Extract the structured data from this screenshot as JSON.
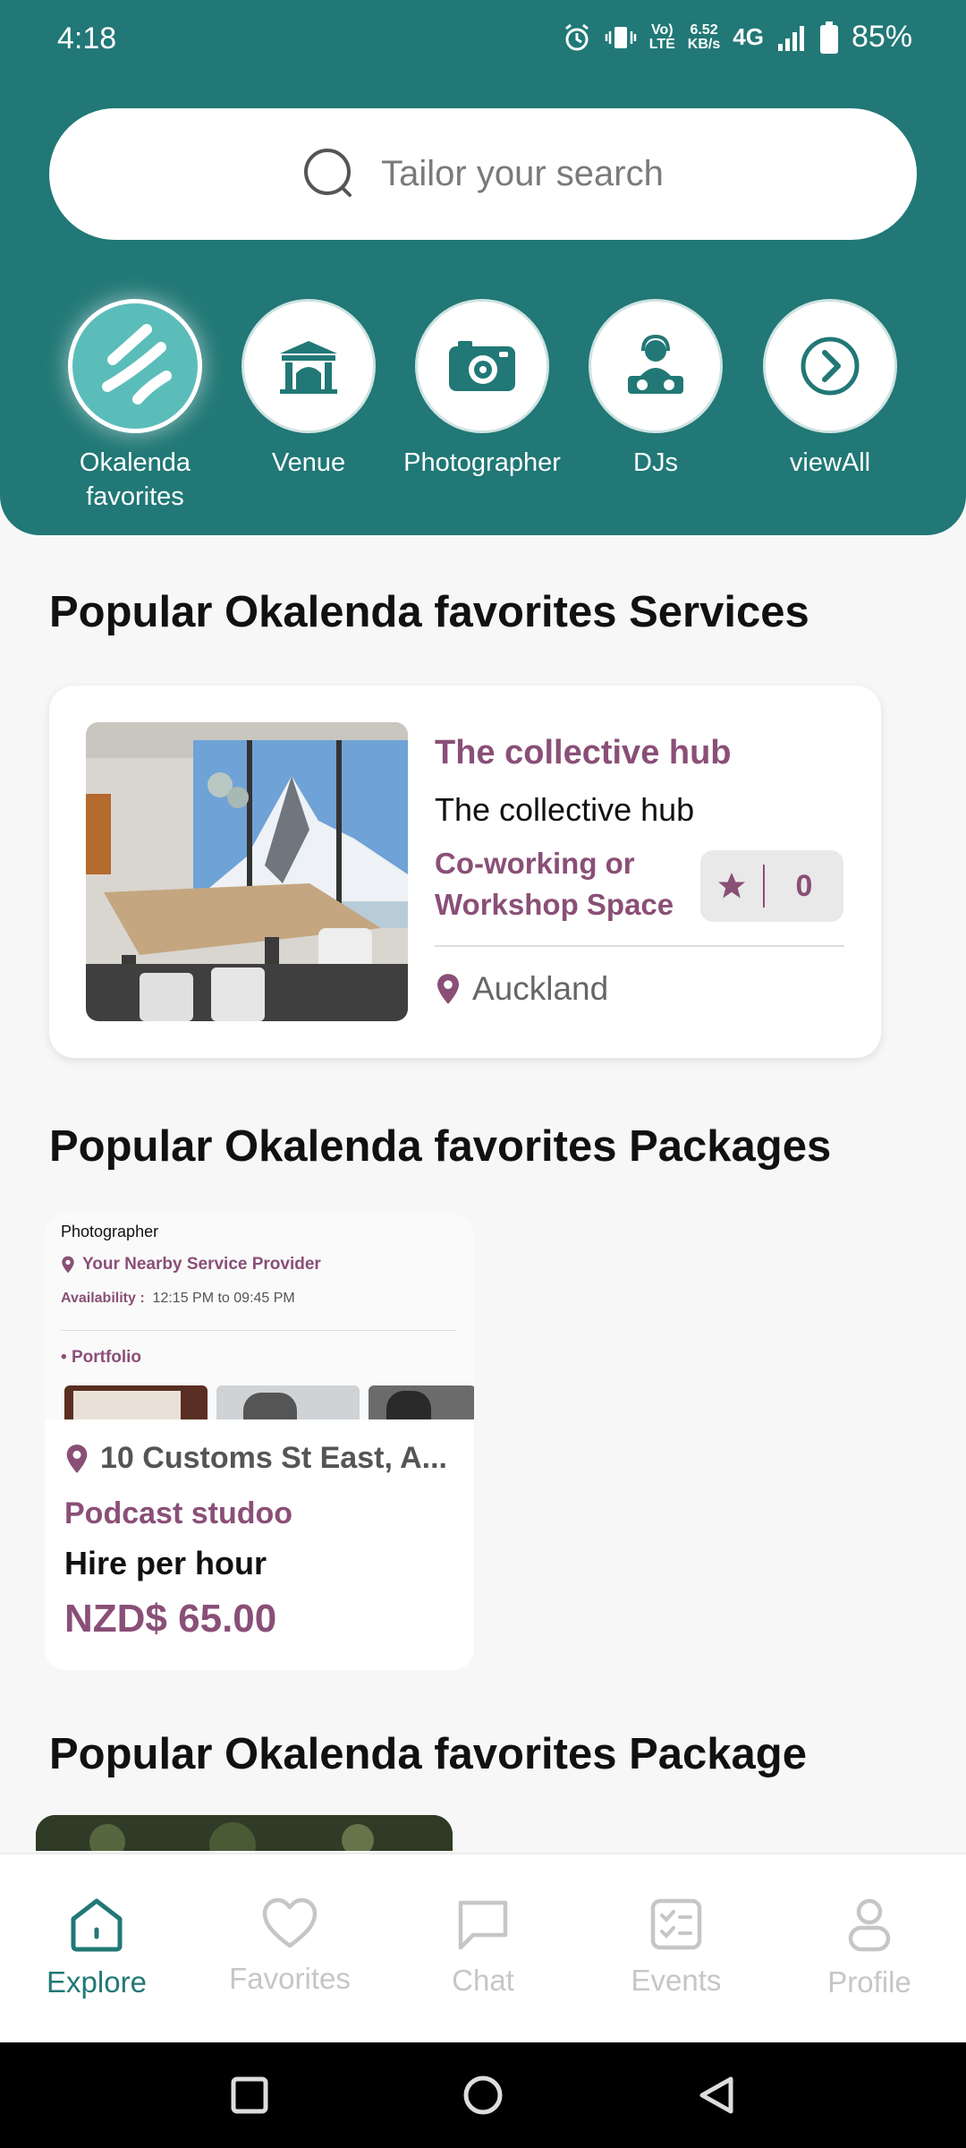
{
  "status": {
    "time": "4:18",
    "net_speed_top": "6.52",
    "net_speed_bottom": "KB/s",
    "network": "4G",
    "volte_top": "Vo)",
    "volte_bottom": "LTE",
    "battery": "85%"
  },
  "search": {
    "placeholder": "Tailor your search"
  },
  "categories": [
    {
      "label": "Okalenda favorites",
      "icon": "okalenda-logo-icon",
      "active": true
    },
    {
      "label": "Venue",
      "icon": "venue-icon"
    },
    {
      "label": "Photographer",
      "icon": "camera-icon"
    },
    {
      "label": "DJs",
      "icon": "dj-icon"
    },
    {
      "label": "viewAll",
      "icon": "chevron-right-circle-icon"
    }
  ],
  "services_section": {
    "title": "Popular Okalenda favorites Services"
  },
  "service_card": {
    "title": "The collective hub",
    "subtitle": "The collective hub",
    "category": "Co-working or Workshop Space",
    "rating": "0",
    "location": "Auckland"
  },
  "packages_section": {
    "title": "Popular Okalenda favorites Packages"
  },
  "package_card": {
    "preview": {
      "type": "Photographer",
      "provider": "Your Nearby Service Provider",
      "availability_label": "Availability :",
      "availability_value": "12:15 PM to 09:45 PM",
      "portfolio": "Portfolio"
    },
    "location": "10 Customs St East, A...",
    "name": "Podcast studoo",
    "type": "Hire per hour",
    "price": "NZD$ 65.00"
  },
  "package_section2": {
    "title": "Popular Okalenda favorites Package"
  },
  "nav": [
    {
      "label": "Explore",
      "icon": "home-icon",
      "active": true
    },
    {
      "label": "Favorites",
      "icon": "heart-icon"
    },
    {
      "label": "Chat",
      "icon": "chat-icon"
    },
    {
      "label": "Events",
      "icon": "checklist-icon"
    },
    {
      "label": "Profile",
      "icon": "profile-icon"
    }
  ],
  "colors": {
    "primary": "#217876",
    "accent": "#8a4f77",
    "background": "#f7f7f7"
  }
}
